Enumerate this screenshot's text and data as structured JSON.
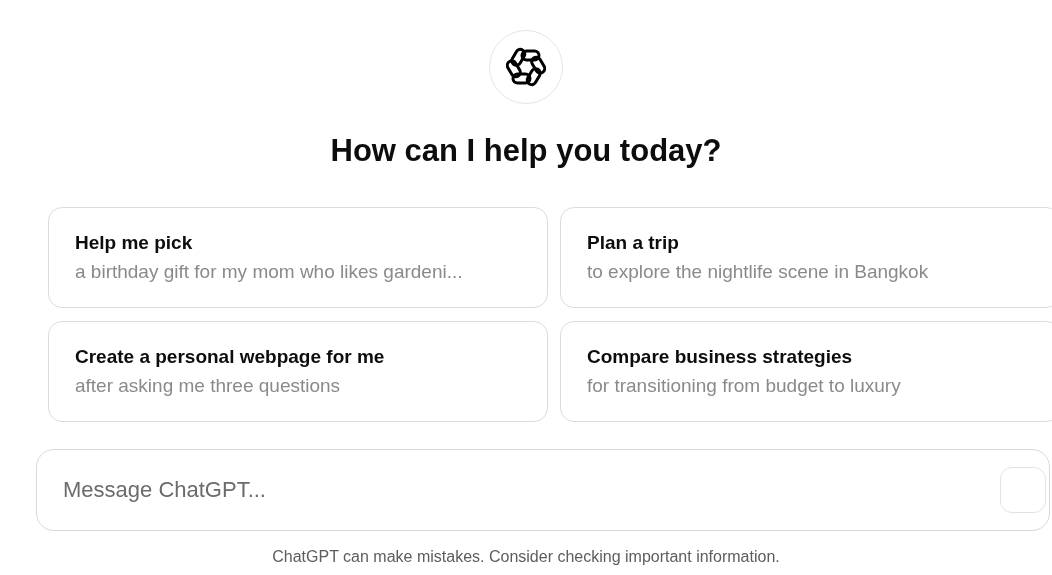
{
  "heading": "How can I help you today?",
  "suggestions": [
    {
      "title": "Help me pick",
      "subtitle": "a birthday gift for my mom who likes gardeni..."
    },
    {
      "title": "Plan a trip",
      "subtitle": "to explore the nightlife scene in Bangkok"
    },
    {
      "title": "Create a personal webpage for me",
      "subtitle": "after asking me three questions"
    },
    {
      "title": "Compare business strategies",
      "subtitle": "for transitioning from budget to luxury"
    }
  ],
  "composer": {
    "placeholder": "Message ChatGPT...",
    "send_disabled": true
  },
  "disclaimer": "ChatGPT can make mistakes. Consider checking important information."
}
